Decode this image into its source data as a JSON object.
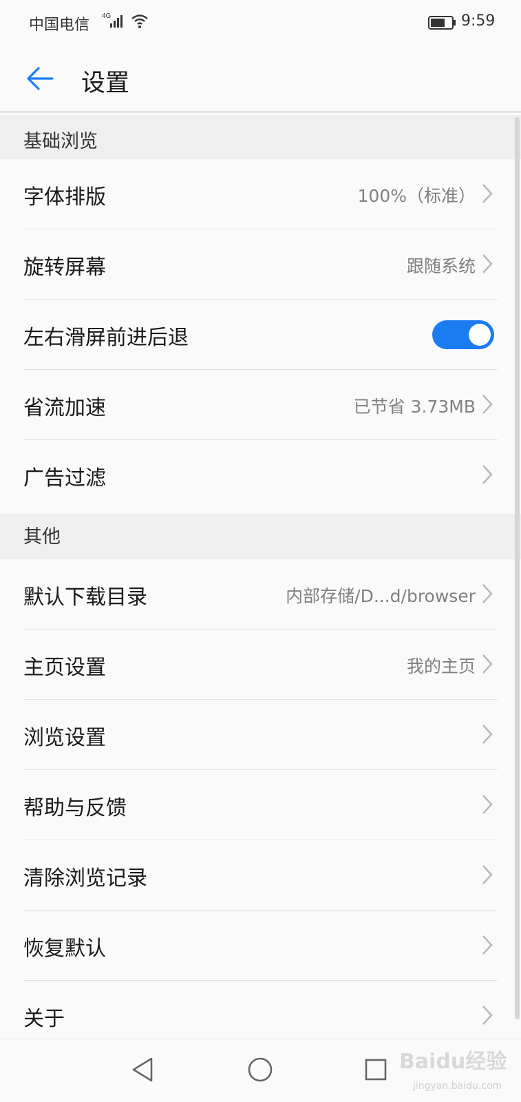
{
  "status_bar": {
    "carrier": "中国电信",
    "network": "4G",
    "time": "9:59"
  },
  "app_bar": {
    "title": "设置"
  },
  "sections": [
    {
      "header": "基础浏览",
      "items": [
        {
          "label": "字体排版",
          "value": "100%（标准）",
          "type": "chevron"
        },
        {
          "label": "旋转屏幕",
          "value": "跟随系统",
          "type": "chevron"
        },
        {
          "label": "左右滑屏前进后退",
          "value": "",
          "type": "toggle",
          "toggle_on": true
        },
        {
          "label": "省流加速",
          "value": "已节省 3.73MB",
          "type": "chevron"
        },
        {
          "label": "广告过滤",
          "value": "",
          "type": "chevron"
        }
      ]
    },
    {
      "header": "其他",
      "items": [
        {
          "label": "默认下载目录",
          "value": "内部存储/D...d/browser",
          "type": "chevron"
        },
        {
          "label": "主页设置",
          "value": "我的主页",
          "type": "chevron"
        },
        {
          "label": "浏览设置",
          "value": "",
          "type": "chevron"
        },
        {
          "label": "帮助与反馈",
          "value": "",
          "type": "chevron"
        },
        {
          "label": "清除浏览记录",
          "value": "",
          "type": "chevron"
        },
        {
          "label": "恢复默认",
          "value": "",
          "type": "chevron"
        },
        {
          "label": "关于",
          "value": "",
          "type": "chevron"
        }
      ]
    }
  ],
  "colors": {
    "accent": "#1b7cf2",
    "back_arrow": "#1b7cf2",
    "section_bg": "#efefef",
    "value_text": "#808080"
  },
  "icons": {
    "back": "arrow-left-icon",
    "chevron": "chevron-right-icon",
    "nav_back": "triangle-back-icon",
    "nav_home": "circle-home-icon",
    "nav_recent": "square-recent-icon"
  },
  "watermark": {
    "text": "Baidu经验",
    "url": "jingyan.baidu.com"
  }
}
